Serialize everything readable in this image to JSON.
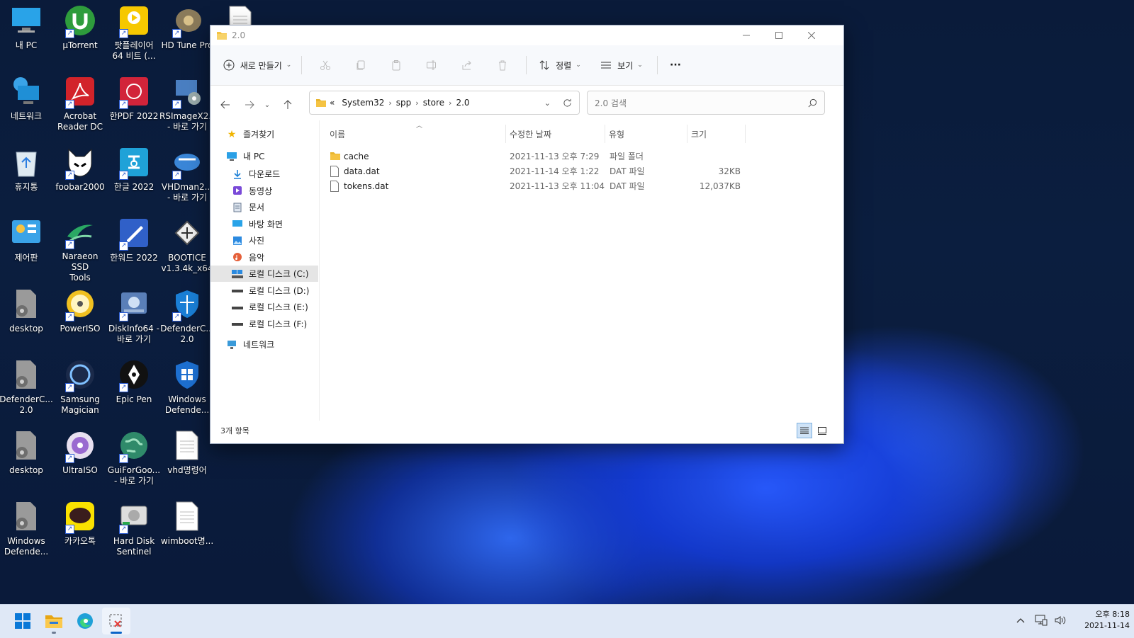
{
  "desktop": {
    "icons": [
      {
        "label": "내 PC",
        "icon": "monitor-icon"
      },
      {
        "label": "µTorrent",
        "icon": "utorrent-icon"
      },
      {
        "label": "팟플레이어\n64 비트 (...",
        "icon": "potplayer-icon"
      },
      {
        "label": "HD Tune Pro",
        "icon": "hdtune-icon"
      },
      {
        "label": "",
        "icon": "document-icon"
      },
      {
        "label": "네트워크",
        "icon": "network-icon"
      },
      {
        "label": "Acrobat\nReader DC",
        "icon": "acrobat-icon"
      },
      {
        "label": "한PDF 2022",
        "icon": "hanpdf-icon"
      },
      {
        "label": "RSImageX2...\n- 바로 가기",
        "icon": "rsimagex-icon"
      },
      {
        "label": "휴지통",
        "icon": "recycle-bin-icon"
      },
      {
        "label": "foobar2000",
        "icon": "foobar-icon"
      },
      {
        "label": "한글 2022",
        "icon": "hangul-icon"
      },
      {
        "label": "VHDman2...\n- 바로 가기",
        "icon": "vhdman-icon"
      },
      {
        "label": "제어판",
        "icon": "control-panel-icon"
      },
      {
        "label": "Naraeon SSD\nTools",
        "icon": "naraeon-icon"
      },
      {
        "label": "한워드 2022",
        "icon": "hanword-icon"
      },
      {
        "label": "BOOTICE\nv1.3.4k_x64",
        "icon": "bootice-icon"
      },
      {
        "label": "desktop",
        "icon": "settings-file-icon"
      },
      {
        "label": "PowerISO",
        "icon": "poweriso-icon"
      },
      {
        "label": "DiskInfo64 -\n바로 가기",
        "icon": "diskinfo-icon"
      },
      {
        "label": "DefenderC...\n2.0",
        "icon": "defender-icon"
      },
      {
        "label": "DefenderC...\n2.0",
        "icon": "settings-file-icon"
      },
      {
        "label": "Samsung\nMagician",
        "icon": "magician-icon"
      },
      {
        "label": "Epic Pen",
        "icon": "epicpen-icon"
      },
      {
        "label": "Windows\nDefende...",
        "icon": "windows-defender-icon"
      },
      {
        "label": "desktop",
        "icon": "settings-file-icon"
      },
      {
        "label": "UltraISO",
        "icon": "ultraiso-icon"
      },
      {
        "label": "GuiForGoo...\n- 바로 가기",
        "icon": "globe-icon"
      },
      {
        "label": "vhd명령어",
        "icon": "document-icon"
      },
      {
        "label": "Windows\nDefende...",
        "icon": "settings-file-icon"
      },
      {
        "label": "카카오톡",
        "icon": "kakaotalk-icon"
      },
      {
        "label": "Hard Disk\nSentinel",
        "icon": "hdsentinel-icon"
      },
      {
        "label": "wimboot명...",
        "icon": "document-icon"
      }
    ]
  },
  "window": {
    "title": "2.0",
    "toolbar": {
      "new_label": "새로 만들기",
      "sort_label": "정렬",
      "view_label": "보기",
      "more_label": "···"
    },
    "breadcrumb": {
      "overflow": "«",
      "items": [
        "System32",
        "spp",
        "store",
        "2.0"
      ]
    },
    "search": {
      "placeholder": "2.0 검색"
    },
    "sidebar": {
      "favorites": "즐겨찾기",
      "this_pc": "내 PC",
      "items": [
        {
          "label": "다운로드",
          "icon": "download-icon"
        },
        {
          "label": "동영상",
          "icon": "video-icon"
        },
        {
          "label": "문서",
          "icon": "documents-icon"
        },
        {
          "label": "바탕 화면",
          "icon": "desktop-icon"
        },
        {
          "label": "사진",
          "icon": "pictures-icon"
        },
        {
          "label": "음악",
          "icon": "music-icon"
        },
        {
          "label": "로컬 디스크 (C:)",
          "icon": "system-drive-icon"
        },
        {
          "label": "로컬 디스크 (D:)",
          "icon": "drive-icon"
        },
        {
          "label": "로컬 디스크 (E:)",
          "icon": "drive-icon"
        },
        {
          "label": "로컬 디스크 (F:)",
          "icon": "drive-icon"
        }
      ],
      "network": "네트워크"
    },
    "columns": {
      "name": "이름",
      "date": "수정한 날짜",
      "type": "유형",
      "size": "크기"
    },
    "files": [
      {
        "name": "cache",
        "date": "2021-11-13 오후 7:29",
        "type": "파일 폴더",
        "size": "",
        "icon": "folder-icon"
      },
      {
        "name": "data.dat",
        "date": "2021-11-14 오후 1:22",
        "type": "DAT 파일",
        "size": "32KB",
        "icon": "file-icon"
      },
      {
        "name": "tokens.dat",
        "date": "2021-11-13 오후 11:04",
        "type": "DAT 파일",
        "size": "12,037KB",
        "icon": "file-icon"
      }
    ],
    "status": "3개 항목"
  },
  "taskbar": {
    "clock_time": "오후 8:18",
    "clock_date": "2021-11-14"
  },
  "colors": {
    "accent": "#0a64c8",
    "folder": "#f5c342",
    "taskbar": "#dfe8f6"
  }
}
